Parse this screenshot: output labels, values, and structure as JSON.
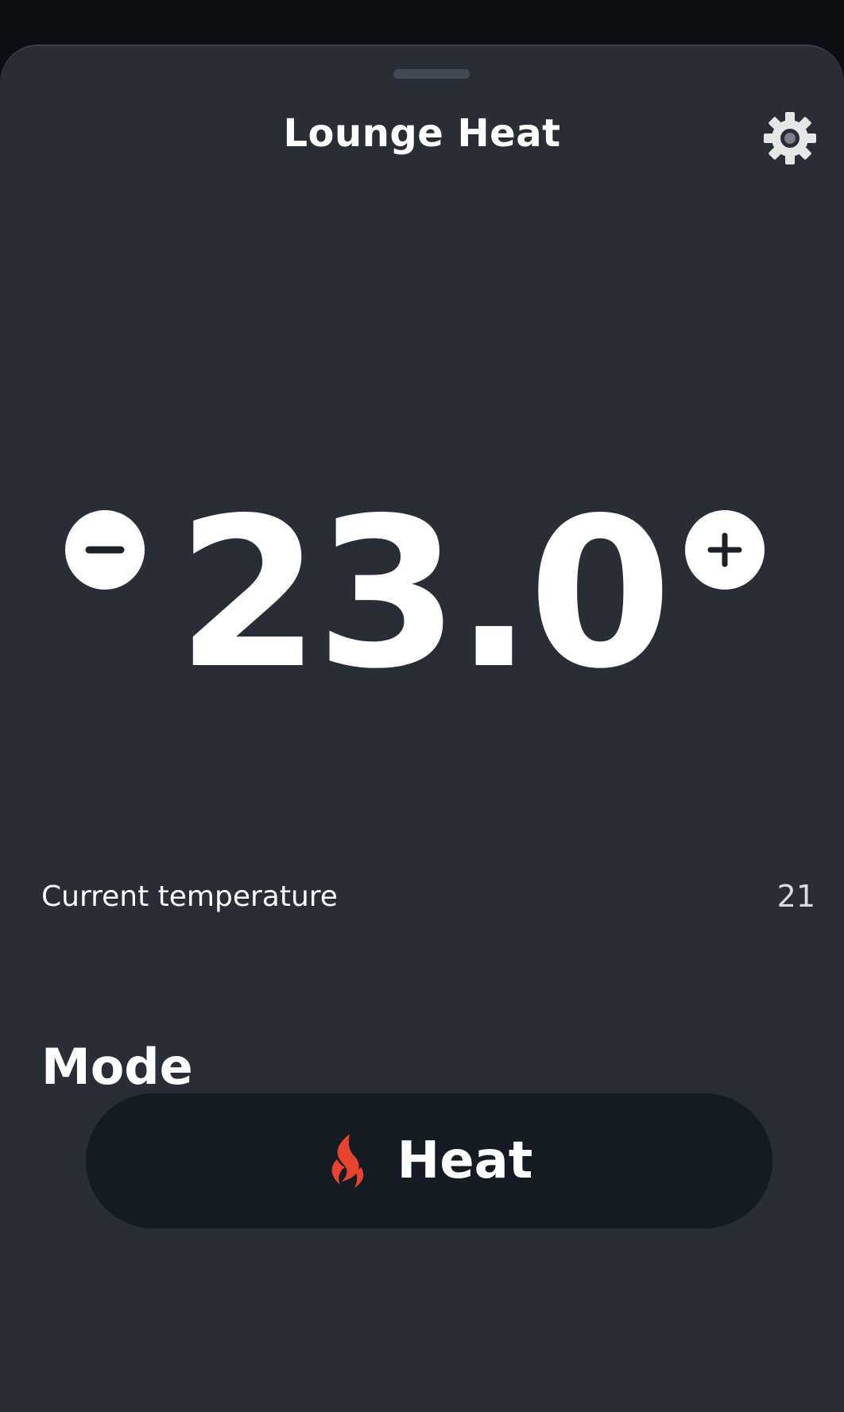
{
  "header": {
    "title": "Lounge Heat"
  },
  "thermostat": {
    "setpoint": "23.0",
    "current_label": "Current temperature",
    "current_value": "21"
  },
  "mode": {
    "heading": "Mode",
    "selected_label": "Heat",
    "icon": "flame-icon"
  },
  "colors": {
    "background": "#292d36",
    "button_bg": "#151b22",
    "flame": "#e8432f",
    "text": "#ffffff"
  }
}
